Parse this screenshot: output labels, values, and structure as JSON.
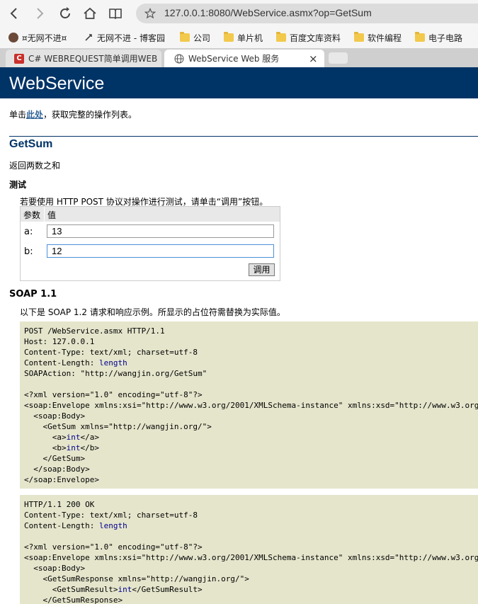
{
  "browser": {
    "url": "127.0.0.1:8080/WebService.asmx?op=GetSum",
    "bookmarks": [
      "¤无网不进¤",
      "无网不进 - 博客园",
      "公司",
      "单片机",
      "百度文库资料",
      "软件编程",
      "电子电路"
    ],
    "tabs": [
      {
        "title": "C# WEBREQUEST简单调用WEB"
      },
      {
        "title": "WebService Web 服务",
        "close": "×"
      }
    ]
  },
  "page": {
    "heading": "WebService",
    "intro_prefix": "单击",
    "intro_link": "此处",
    "intro_suffix": "，获取完整的操作列表。",
    "op_name": "GetSum",
    "op_desc": "返回两数之和",
    "test_title": "测试",
    "test_desc": "若要使用 HTTP POST 协议对操作进行测试，请单击“调用”按钮。",
    "param_header": "参数",
    "value_header": "值",
    "params": [
      {
        "name": "a:",
        "value": "13"
      },
      {
        "name": "b:",
        "value": "12"
      }
    ],
    "invoke_label": "调用",
    "soap_title": "SOAP 1.1",
    "soap_desc": "以下是 SOAP 1.2 请求和响应示例。所显示的占位符需替换为实际值。",
    "request_lines": [
      "POST /WebService.asmx HTTP/1.1",
      "Host: 127.0.0.1",
      "Content-Type: text/xml; charset=utf-8",
      "Content-Length: length",
      "SOAPAction: \"http://wangjin.org/GetSum\"",
      "",
      "<?xml version=\"1.0\" encoding=\"utf-8\"?>",
      "<soap:Envelope xmlns:xsi=\"http://www.w3.org/2001/XMLSchema-instance\" xmlns:xsd=\"http://www.w3.org/2001/XMLSchema\" xmlns:soap=\"http://schemas.xmlsoap.org/soap/envelope/\">",
      "  <soap:Body>",
      "    <GetSum xmlns=\"http://wangjin.org/\">",
      "      <a>int</a>",
      "      <b>int</b>",
      "    </GetSum>",
      "  </soap:Body>",
      "</soap:Envelope>"
    ],
    "response_lines": [
      "HTTP/1.1 200 OK",
      "Content-Type: text/xml; charset=utf-8",
      "Content-Length: length",
      "",
      "<?xml version=\"1.0\" encoding=\"utf-8\"?>",
      "<soap:Envelope xmlns:xsi=\"http://www.w3.org/2001/XMLSchema-instance\" xmlns:xsd=\"http://www.w3.org/2001/XMLSchema\" xmlns:soap=\"http://schemas.xmlsoap.org/soap/envelope/\">",
      "  <soap:Body>",
      "    <GetSumResponse xmlns=\"http://wangjin.org/\">",
      "      <GetSumResult>int</GetSumResult>",
      "    </GetSumResponse>"
    ],
    "placeholder_word": "length",
    "type_word": "int"
  },
  "colors": {
    "header_bg": "#003366",
    "code_bg": "#e5e5cc",
    "placeholder": "#00008b"
  }
}
